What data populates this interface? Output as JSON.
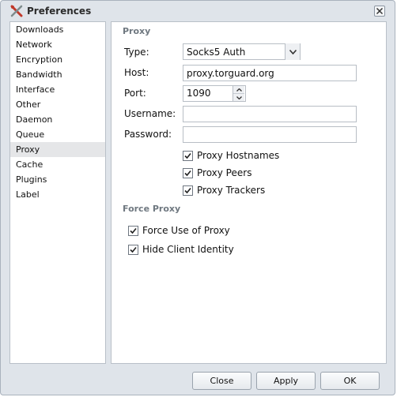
{
  "window": {
    "title": "Preferences"
  },
  "sidebar": {
    "items": [
      {
        "label": "Downloads"
      },
      {
        "label": "Network"
      },
      {
        "label": "Encryption"
      },
      {
        "label": "Bandwidth"
      },
      {
        "label": "Interface"
      },
      {
        "label": "Other"
      },
      {
        "label": "Daemon"
      },
      {
        "label": "Queue"
      },
      {
        "label": "Proxy"
      },
      {
        "label": "Cache"
      },
      {
        "label": "Plugins"
      },
      {
        "label": "Label"
      }
    ],
    "selected": "Proxy"
  },
  "proxy": {
    "heading": "Proxy",
    "type_label": "Type:",
    "type_value": "Socks5 Auth",
    "host_label": "Host:",
    "host_value": "proxy.torguard.org",
    "port_label": "Port:",
    "port_value": "1090",
    "username_label": "Username:",
    "username_value": "",
    "password_label": "Password:",
    "password_value": "",
    "checks": [
      {
        "label": "Proxy Hostnames",
        "checked": true
      },
      {
        "label": "Proxy Peers",
        "checked": true
      },
      {
        "label": "Proxy Trackers",
        "checked": true
      }
    ]
  },
  "force_proxy": {
    "heading": "Force Proxy",
    "checks": [
      {
        "label": "Force Use of Proxy",
        "checked": true
      },
      {
        "label": "Hide Client Identity",
        "checked": true
      }
    ]
  },
  "footer": {
    "close_label": "Close",
    "apply_label": "Apply",
    "ok_label": "OK"
  },
  "icons": {
    "app": "tools-icon",
    "close": "close-icon",
    "dropdown": "chevron-down-icon",
    "spin_up": "spin-up-icon",
    "spin_down": "spin-down-icon",
    "check": "check-icon"
  }
}
